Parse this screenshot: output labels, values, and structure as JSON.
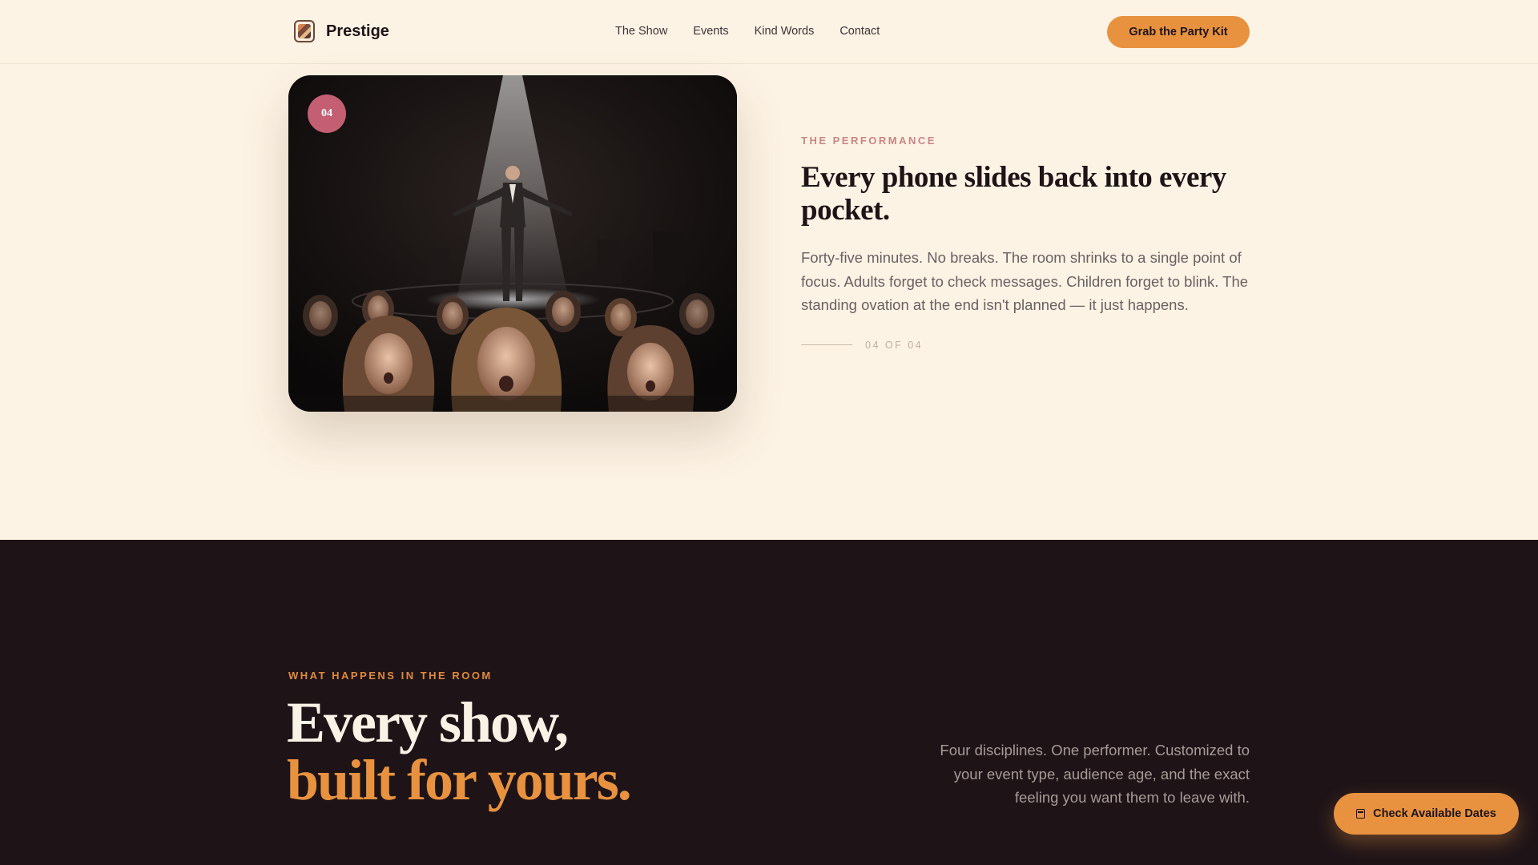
{
  "header": {
    "brand": {
      "name": "Prestige",
      "logo_icon": "theater-masks-icon"
    },
    "nav": [
      "The Show",
      "Events",
      "Kind Words",
      "Contact"
    ],
    "cta_label": "Grab the Party Kit"
  },
  "performance": {
    "step_badge": "04",
    "eyebrow": "THE PERFORMANCE",
    "title": "Every phone slides back into every pocket.",
    "body": "Forty-five minutes. No breaks. The room shrinks to a single point of focus. Adults forget to check messages. Children forget to blink. The standing ovation at the end isn't planned — it just happens.",
    "counter": "04 OF 04"
  },
  "room_section": {
    "eyebrow": "WHAT HAPPENS IN THE ROOM",
    "title_line1": "Every show,",
    "title_line2": "built for yours.",
    "description": "Four disciplines. One performer. Customized to your event type, audience age, and the exact feeling you want them to leave with."
  },
  "floating_cta": {
    "label": "Check Available Dates",
    "icon": "calendar-icon"
  },
  "colors": {
    "accent": "#e8923f",
    "rose": "#c45f73",
    "dark_bg": "#1e1418",
    "cream_bg": "#fdf3e4"
  }
}
